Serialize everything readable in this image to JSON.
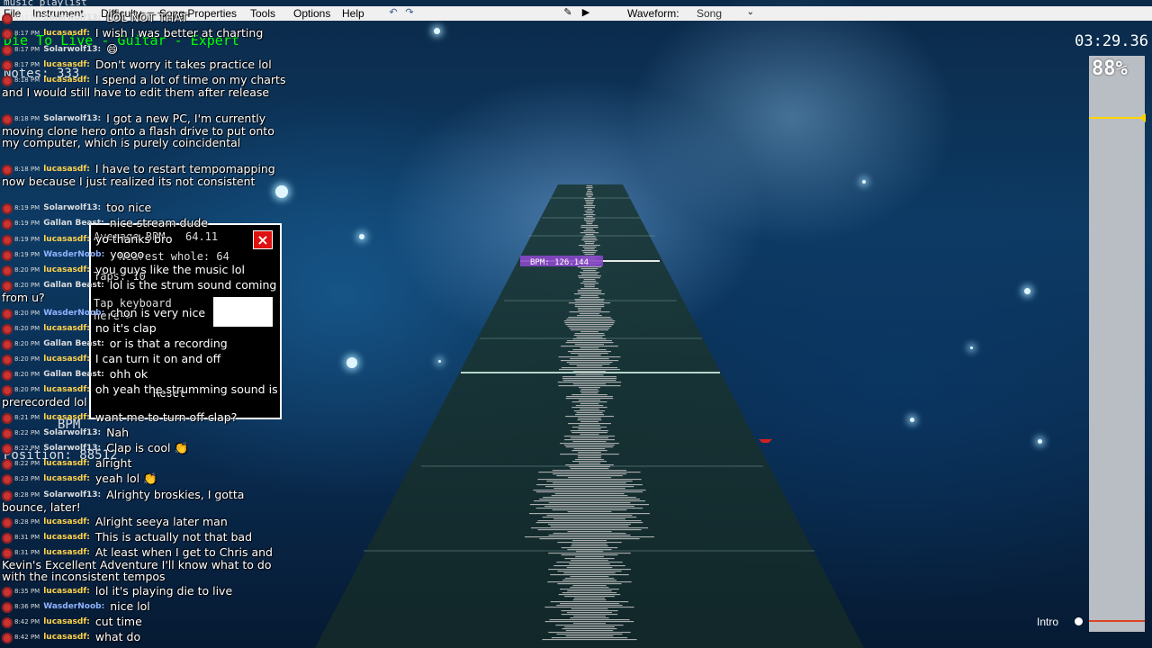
{
  "menu": [
    "File",
    "Instrument",
    "Difficulty",
    "Song Properties",
    "Tools",
    "Options",
    "Help"
  ],
  "waveform": {
    "label": "Waveform:",
    "value": "Song"
  },
  "timer": "03:29.36",
  "progress_percent": "88%",
  "progress_fraction": 0.88,
  "section_label": "Intro",
  "bpm_marker": "BPM: 126.144",
  "info_panel": {
    "playlist": "music playlist",
    "title": "Die To Live - Guitar - Expert",
    "notes": "Notes: 333",
    "position": "Position: 88512",
    "bpm": "BPM"
  },
  "bpm_dialog": {
    "avg_label": "Average BPM",
    "avg_value": "64.11",
    "nearest_label": "Nearest whole: 64",
    "taps": "Taps: 10",
    "instruction": "Tap keyboard here->",
    "reset": "Reset",
    "close": "×"
  },
  "chat": [
    {
      "ts": "8:17 PM",
      "user": "Solarwolf13:",
      "text": "LOL NOT THAT",
      "ucls": "gray"
    },
    {
      "ts": "8:17 PM",
      "user": "lucasasdf:",
      "text": "I wish I was better at charting",
      "ucls": ""
    },
    {
      "ts": "8:17 PM",
      "user": "Solarwolf13:",
      "text": "😄",
      "ucls": "gray"
    },
    {
      "ts": "8:17 PM",
      "user": "lucasasdf:",
      "text": "Don't worry it takes practice lol",
      "ucls": ""
    },
    {
      "ts": "8:18 PM",
      "user": "lucasasdf:",
      "text": "I spend a lot of time on my charts and I would still have to edit them after release",
      "ucls": ""
    },
    {
      "ts": "8:18 PM",
      "user": "Solarwolf13:",
      "text": "I got a new PC, I'm currently moving clone hero onto a flash drive to put onto my computer, which is purely coincidental",
      "ucls": "gray"
    },
    {
      "ts": "8:18 PM",
      "user": "lucasasdf:",
      "text": "I have to restart tempomapping now because I just realized its not consistent",
      "ucls": ""
    },
    {
      "ts": "8:19 PM",
      "user": "Solarwolf13:",
      "text": "too nice",
      "ucls": "gray"
    },
    {
      "ts": "8:19 PM",
      "user": "Gallan Beast:",
      "text": "nice stream dude",
      "ucls": "gray"
    },
    {
      "ts": "8:19 PM",
      "user": "lucasasdf:",
      "text": "yo thanks bro",
      "ucls": ""
    },
    {
      "ts": "8:19 PM",
      "user": "WasderNoob:",
      "text": "yoooo",
      "ucls": "blue"
    },
    {
      "ts": "8:20 PM",
      "user": "lucasasdf:",
      "text": "you guys like the music lol",
      "ucls": ""
    },
    {
      "ts": "8:20 PM",
      "user": "Gallan Beast:",
      "text": "lol is the strum sound coming from u?",
      "ucls": "gray"
    },
    {
      "ts": "8:20 PM",
      "user": "WasderNoob:",
      "text": "chon is very nice",
      "ucls": "blue"
    },
    {
      "ts": "8:20 PM",
      "user": "lucasasdf:",
      "text": "no it's clap",
      "ucls": ""
    },
    {
      "ts": "8:20 PM",
      "user": "Gallan Beast:",
      "text": "or is that a recording",
      "ucls": "gray"
    },
    {
      "ts": "8:20 PM",
      "user": "lucasasdf:",
      "text": "I can turn it on and off",
      "ucls": ""
    },
    {
      "ts": "8:20 PM",
      "user": "Gallan Beast:",
      "text": "ohh ok",
      "ucls": "gray"
    },
    {
      "ts": "8:20 PM",
      "user": "lucasasdf:",
      "text": "oh yeah the strumming sound is prerecorded lol",
      "ucls": ""
    },
    {
      "ts": "8:21 PM",
      "user": "lucasasdf:",
      "text": "want me to turn off clap?",
      "ucls": ""
    },
    {
      "ts": "8:22 PM",
      "user": "Solarwolf13:",
      "text": "Nah",
      "ucls": "gray"
    },
    {
      "ts": "8:22 PM",
      "user": "Solarwolf13:",
      "text": "Clap is cool 👏",
      "ucls": "gray"
    },
    {
      "ts": "8:22 PM",
      "user": "lucasasdf:",
      "text": "alright",
      "ucls": ""
    },
    {
      "ts": "8:23 PM",
      "user": "lucasasdf:",
      "text": "yeah lol 👏",
      "ucls": ""
    },
    {
      "ts": "8:28 PM",
      "user": "Solarwolf13:",
      "text": "Alrighty broskies, I gotta bounce, later!",
      "ucls": "gray"
    },
    {
      "ts": "8:28 PM",
      "user": "lucasasdf:",
      "text": "Alright seeya later man",
      "ucls": ""
    },
    {
      "ts": "8:31 PM",
      "user": "lucasasdf:",
      "text": "This is actually not that bad",
      "ucls": ""
    },
    {
      "ts": "8:31 PM",
      "user": "lucasasdf:",
      "text": "At least when I get to Chris and Kevin's Excellent Adventure I'll know what to do with the inconsistent tempos",
      "ucls": ""
    },
    {
      "ts": "8:35 PM",
      "user": "lucasasdf:",
      "text": "lol it's playing die to live",
      "ucls": ""
    },
    {
      "ts": "8:36 PM",
      "user": "WasderNoob:",
      "text": "nice lol",
      "ucls": "blue"
    },
    {
      "ts": "8:42 PM",
      "user": "lucasasdf:",
      "text": "cut time",
      "ucls": ""
    },
    {
      "ts": "8:42 PM",
      "user": "lucasasdf:",
      "text": "what do",
      "ucls": ""
    }
  ]
}
